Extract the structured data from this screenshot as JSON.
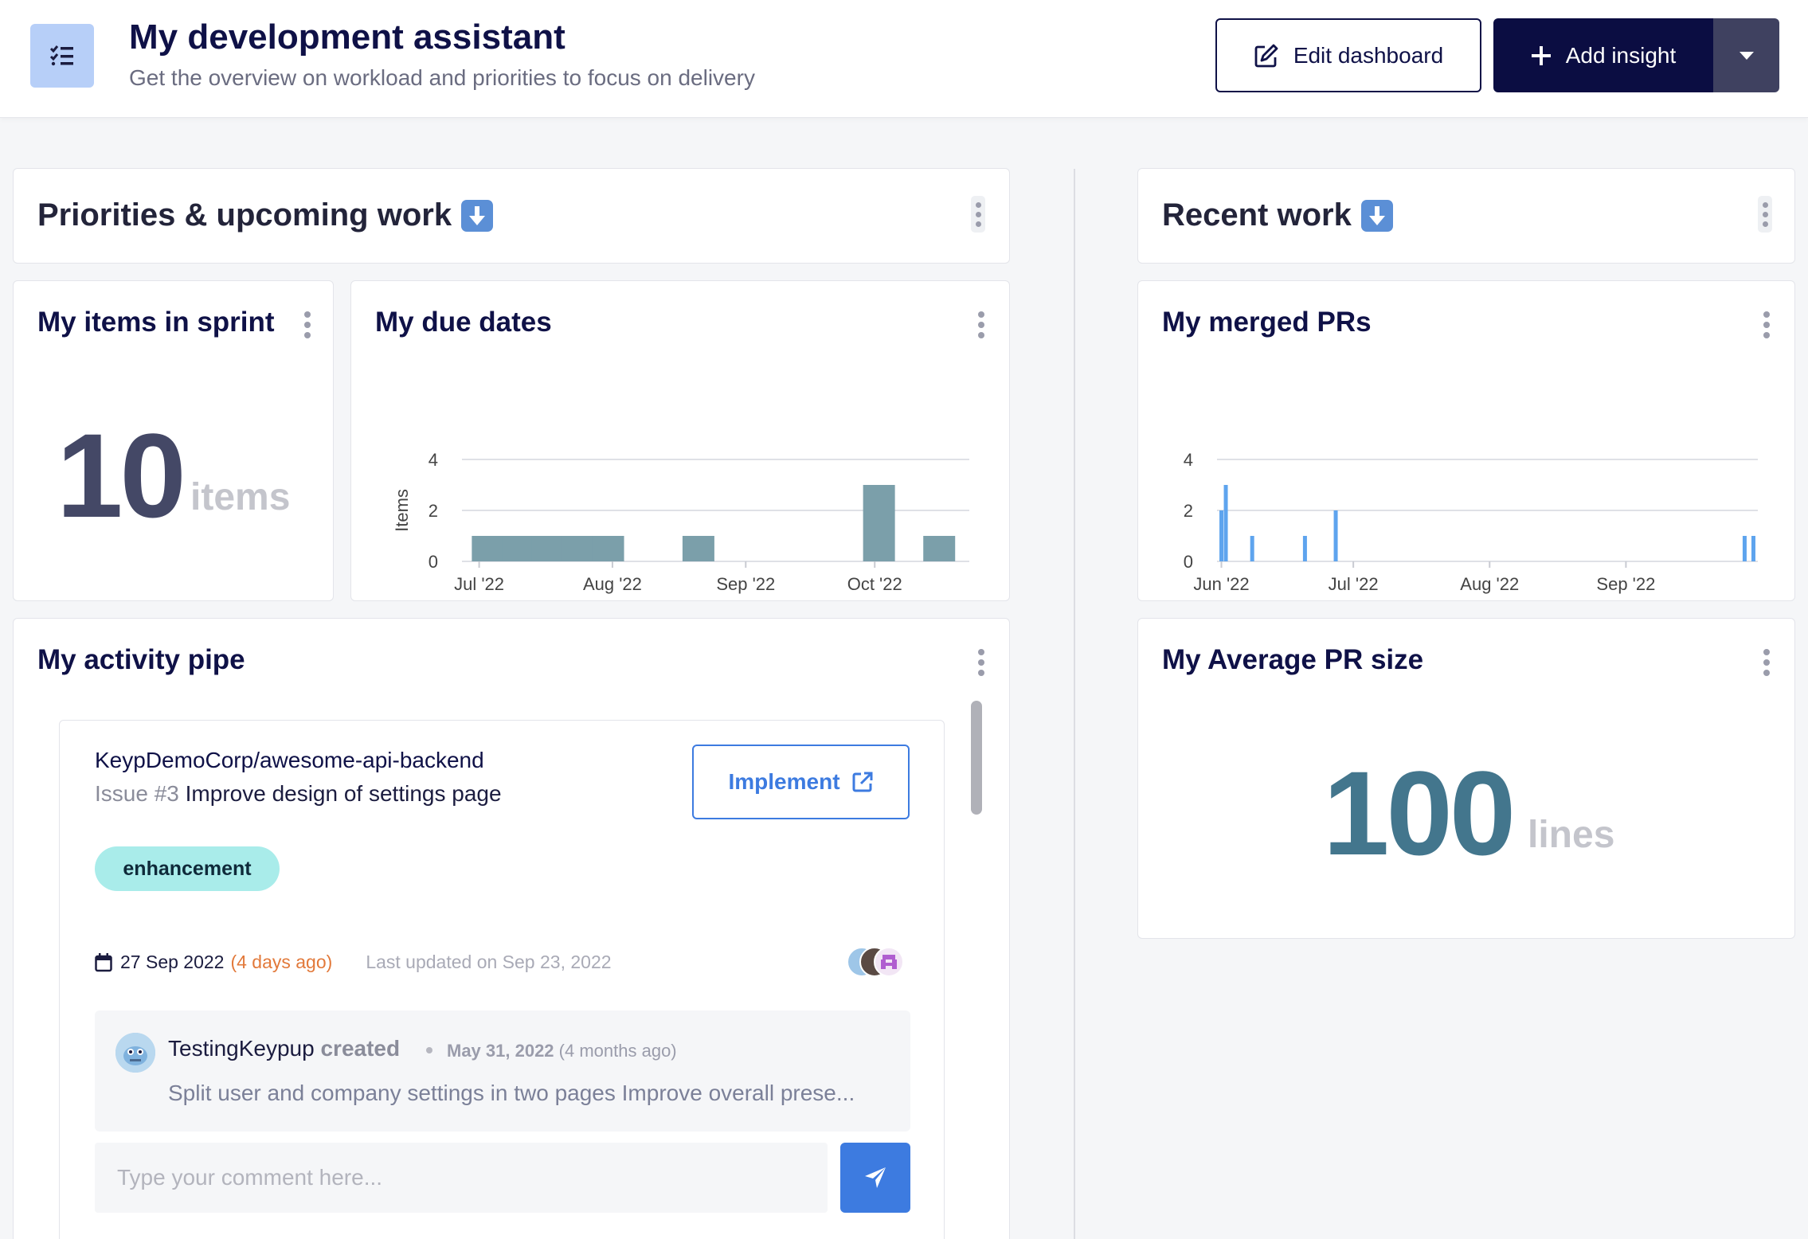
{
  "header": {
    "title": "My development assistant",
    "subtitle": "Get the overview on workload and priorities to focus on delivery",
    "edit_label": "Edit dashboard",
    "add_label": "Add insight"
  },
  "sections": {
    "left_title": "Priorities & upcoming work",
    "right_title": "Recent work"
  },
  "sprint": {
    "title": "My items in sprint",
    "value": "10",
    "unit": "items"
  },
  "avg_pr": {
    "title": "My Average PR size",
    "value": "100",
    "unit": "lines"
  },
  "charts": {
    "due_dates_title": "My due dates",
    "merged_prs_title": "My merged PRs"
  },
  "chart_data": [
    {
      "type": "bar",
      "title": "My due dates",
      "ylabel": "Items",
      "xlabel": "",
      "ylim": [
        0,
        4
      ],
      "yticks": [
        "0",
        "2",
        "4"
      ],
      "xticks": [
        "Jul '22",
        "Aug '22",
        "Sep '22",
        "Oct '22"
      ],
      "grid": true,
      "x": [
        "2022-07-03",
        "2022-07-10",
        "2022-07-17",
        "2022-07-24",
        "2022-07-31",
        "2022-08-21",
        "2022-10-02",
        "2022-10-16"
      ],
      "values": [
        1,
        1,
        1,
        1,
        1,
        1,
        3,
        1
      ],
      "color": "#7b9faa"
    },
    {
      "type": "bar",
      "title": "My merged PRs",
      "ylabel": "",
      "xlabel": "",
      "ylim": [
        0,
        4
      ],
      "yticks": [
        "0",
        "2",
        "4"
      ],
      "xticks": [
        "Jun '22",
        "Jul '22",
        "Aug '22",
        "Sep '22"
      ],
      "grid": true,
      "x": [
        "2022-06-01",
        "2022-06-02",
        "2022-06-08",
        "2022-06-20",
        "2022-06-27",
        "2022-09-28",
        "2022-09-30"
      ],
      "values": [
        2,
        3,
        1,
        1,
        2,
        1,
        1
      ],
      "color": "#5ea4ee"
    }
  ],
  "activity": {
    "title": "My activity pipe",
    "repo": "KeypDemoCorp/awesome-api-backend",
    "issue_prefix": "Issue #3",
    "issue_title": "Improve design of settings page",
    "implement_label": "Implement",
    "tag": "enhancement",
    "due_date": "27 Sep 2022",
    "due_ago": "(4 days ago)",
    "last_updated": "Last updated on Sep 23, 2022",
    "comment": {
      "user": "TestingKeypup",
      "action": "created",
      "date": "May 31, 2022",
      "date_ago": "(4 months ago)",
      "text": "Split user and company settings in two pages Improve overall prese..."
    },
    "input_placeholder": "Type your comment here..."
  }
}
